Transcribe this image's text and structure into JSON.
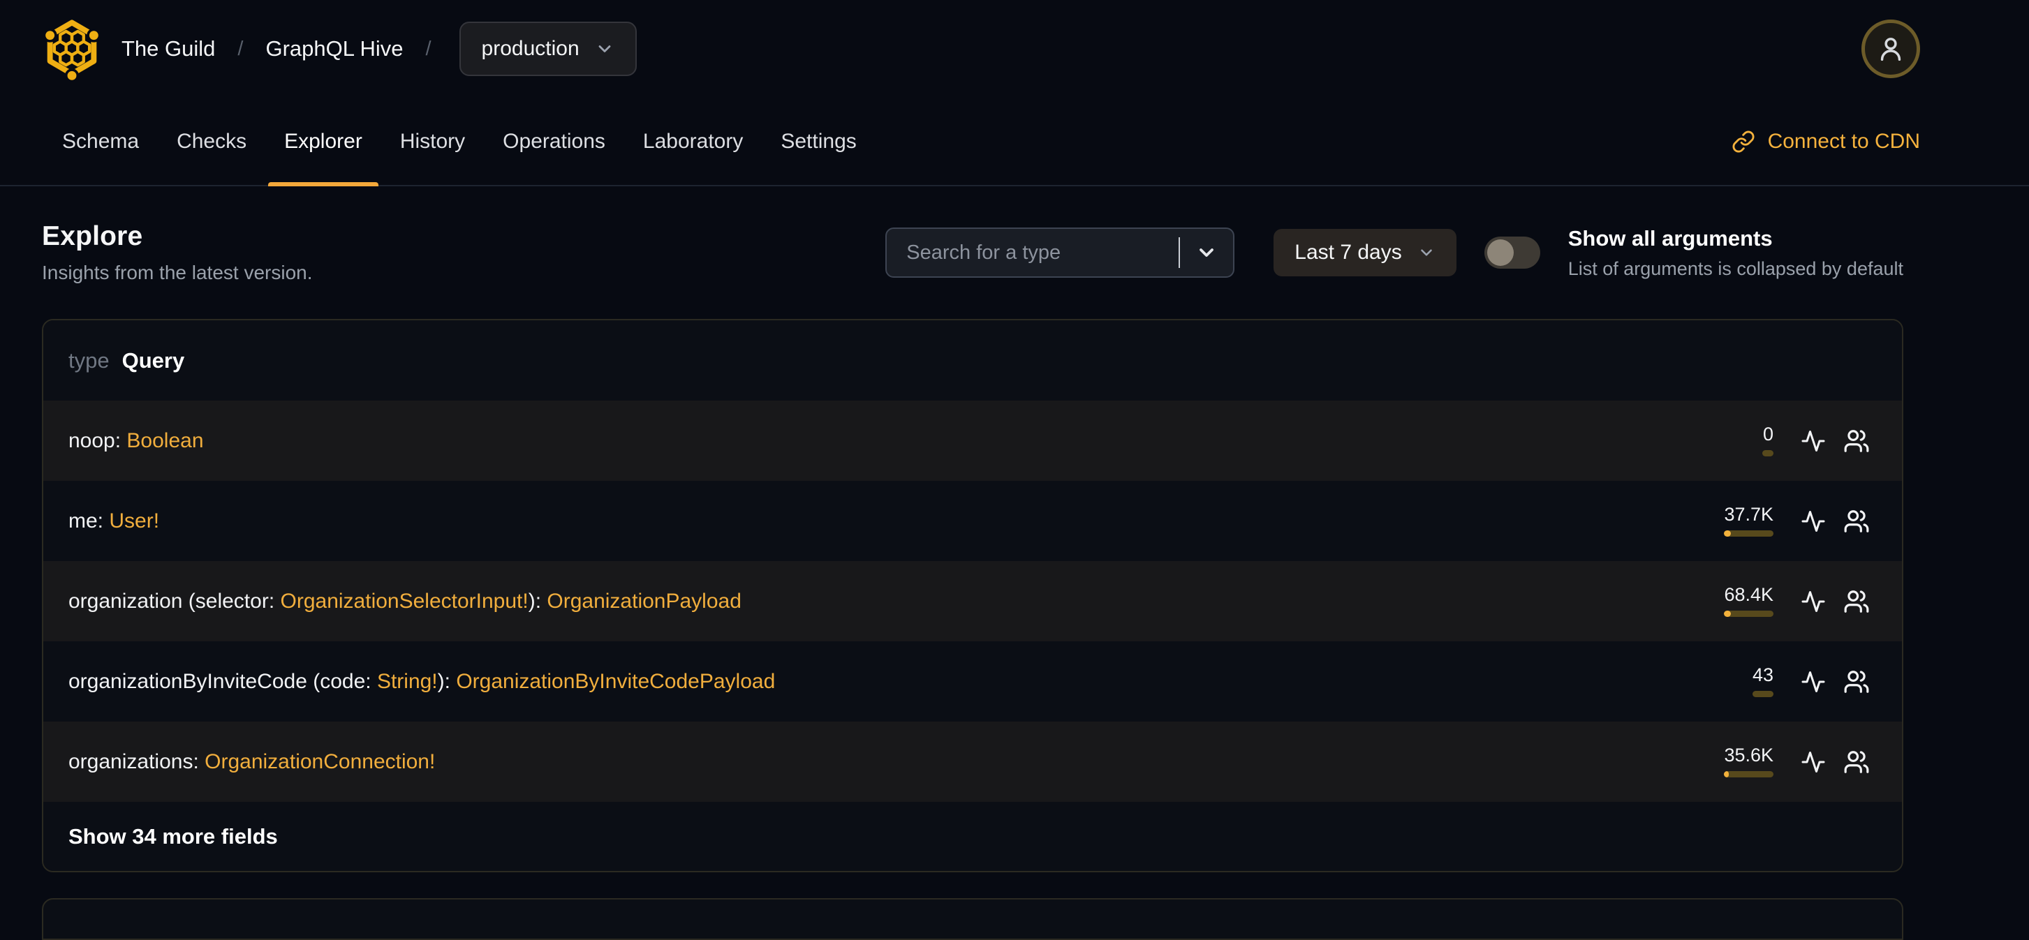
{
  "header": {
    "org": "The Guild",
    "separator": "/",
    "project": "GraphQL Hive",
    "target": "production"
  },
  "nav": {
    "tabs": [
      {
        "label": "Schema",
        "active": false
      },
      {
        "label": "Checks",
        "active": false
      },
      {
        "label": "Explorer",
        "active": true
      },
      {
        "label": "History",
        "active": false
      },
      {
        "label": "Operations",
        "active": false
      },
      {
        "label": "Laboratory",
        "active": false
      },
      {
        "label": "Settings",
        "active": false
      }
    ],
    "connect_cdn": "Connect to CDN"
  },
  "page": {
    "title": "Explore",
    "subtitle": "Insights from the latest version."
  },
  "controls": {
    "search_placeholder": "Search for a type",
    "period": "Last 7 days",
    "arguments_toggle": {
      "label": "Show all arguments",
      "description": "List of arguments is collapsed by default",
      "enabled": false
    }
  },
  "schema_table": {
    "kind": "type",
    "name": "Query",
    "rows": [
      {
        "segments": [
          {
            "text": "noop: ",
            "link": false
          },
          {
            "text": "Boolean",
            "link": true
          }
        ],
        "requests": "0",
        "usage_pct": 0
      },
      {
        "segments": [
          {
            "text": "me: ",
            "link": false
          },
          {
            "text": "User!",
            "link": true
          }
        ],
        "requests": "37.7K",
        "usage_pct": 13
      },
      {
        "segments": [
          {
            "text": "organization (selector: ",
            "link": false
          },
          {
            "text": "OrganizationSelectorInput!",
            "link": true
          },
          {
            "text": "): ",
            "link": false
          },
          {
            "text": "OrganizationPayload",
            "link": true
          }
        ],
        "requests": "68.4K",
        "usage_pct": 14
      },
      {
        "segments": [
          {
            "text": "organizationByInviteCode (code: ",
            "link": false
          },
          {
            "text": "String!",
            "link": true
          },
          {
            "text": "): ",
            "link": false
          },
          {
            "text": "OrganizationByInviteCodePayload",
            "link": true
          }
        ],
        "requests": "43",
        "usage_pct": 0
      },
      {
        "segments": [
          {
            "text": "organizations: ",
            "link": false
          },
          {
            "text": "OrganizationConnection!",
            "link": true
          }
        ],
        "requests": "35.6K",
        "usage_pct": 9
      }
    ],
    "show_more": "Show 34 more fields"
  },
  "colors": {
    "accent": "#f1ae3d",
    "tab_underline": "#f3a83a",
    "usage_track": "#57491c",
    "usage_fill": "#f2b13c",
    "background": "#070a12"
  }
}
